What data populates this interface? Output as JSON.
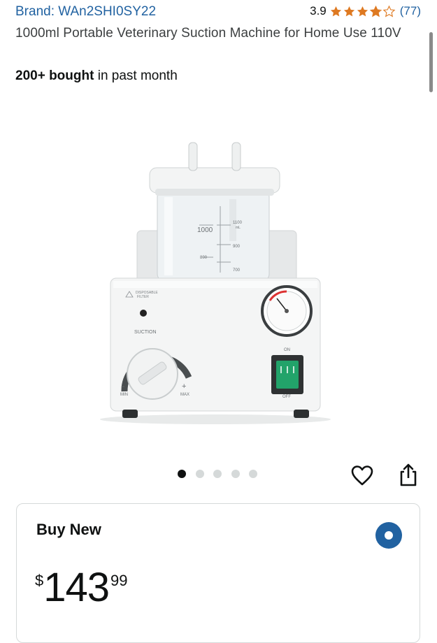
{
  "header": {
    "brand": "Brand: WAn2SHI0SY22",
    "rating_value": "3.9",
    "rating_stars": 3.9,
    "rating_count": "(77)"
  },
  "product": {
    "title": "1000ml Portable Veterinary Suction Machine for Home Use 110V",
    "bought_bold": "200+ bought",
    "bought_rest": " in past month",
    "image_labels": {
      "tick_1100": "1100",
      "tick_ml": "mL",
      "tick_1000": "1000",
      "tick_900": "900",
      "tick_800": "800",
      "tick_700": "700",
      "filter": "DISPOSABLE",
      "filter2": "FILTER",
      "suction": "SUCTION",
      "on": "ON",
      "off": "OFF",
      "min": "MIN",
      "max": "MAX",
      "minus": "−",
      "plus": "+"
    }
  },
  "gallery": {
    "total_images": 5,
    "active_index": 0
  },
  "buy_box": {
    "label": "Buy New",
    "currency": "$",
    "price_whole": "143",
    "price_fraction": "99",
    "selected": true
  },
  "colors": {
    "link": "#2162a1",
    "star": "#de7921",
    "text": "#0f1111"
  },
  "icons": [
    "star-icon",
    "heart-icon",
    "share-icon",
    "radio-selected-icon"
  ]
}
